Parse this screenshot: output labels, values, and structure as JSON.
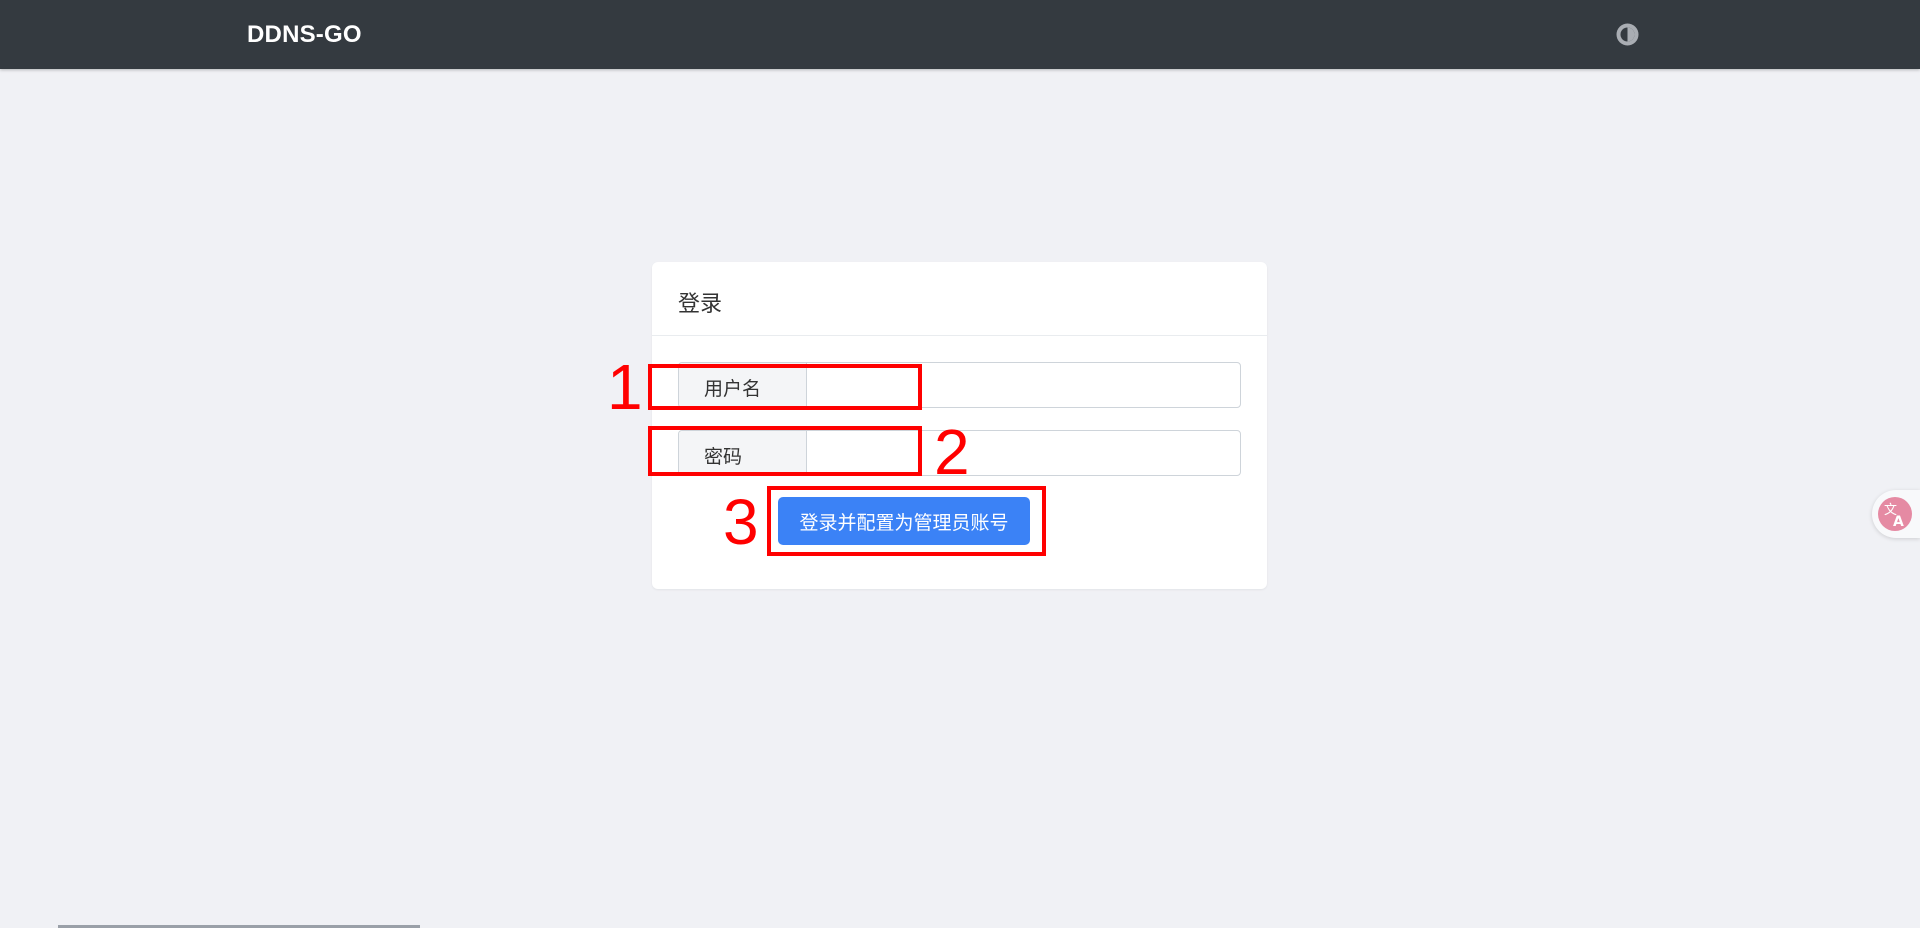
{
  "navbar": {
    "brand": "DDNS-GO",
    "theme_toggle_icon": "half-moon-theme-icon"
  },
  "login": {
    "title": "登录",
    "username_label": "用户名",
    "username_value": "",
    "password_label": "密码",
    "password_value": "",
    "submit_label": "登录并配置为管理员账号"
  },
  "annotations": [
    {
      "number": "1"
    },
    {
      "number": "2"
    },
    {
      "number": "3"
    }
  ],
  "extension": {
    "translate_icon": "translate-icon"
  },
  "colors": {
    "navbar_bg": "#343a40",
    "page_bg": "#f0f1f5",
    "primary": "#3b82f6",
    "annotation": "#ff0000"
  }
}
